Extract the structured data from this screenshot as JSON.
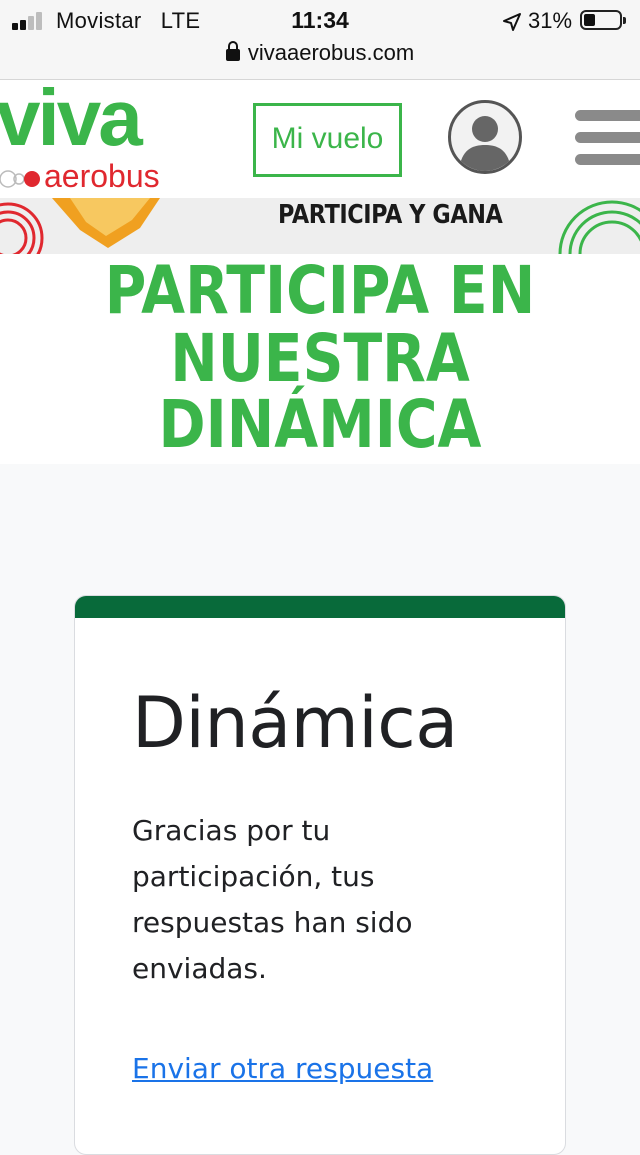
{
  "status_bar": {
    "carrier": "Movistar",
    "network": "LTE",
    "time": "11:34",
    "battery": "31%"
  },
  "browser": {
    "url": "vivaaerobus.com"
  },
  "header": {
    "logo_top": "viva",
    "logo_bottom": "aerobus",
    "my_flight_button": "Mi vuelo"
  },
  "banner": {
    "text": "PARTICIPA Y GANA"
  },
  "hero": {
    "line1": "PARTICIPA EN",
    "line2": "NUESTRA DINÁMICA"
  },
  "form": {
    "title": "Dinámica",
    "confirmation": "Gracias por tu participación, tus respuestas han sido enviadas.",
    "another_response_link": "Enviar otra respuesta"
  },
  "colors": {
    "brand_green": "#3bb54a",
    "brand_red": "#e0282f",
    "form_accent": "#086a3a",
    "link": "#1a73e8"
  },
  "icons": [
    "signal-icon",
    "location-arrow-icon",
    "battery-icon",
    "lock-icon",
    "user-avatar-icon",
    "hamburger-menu-icon"
  ]
}
